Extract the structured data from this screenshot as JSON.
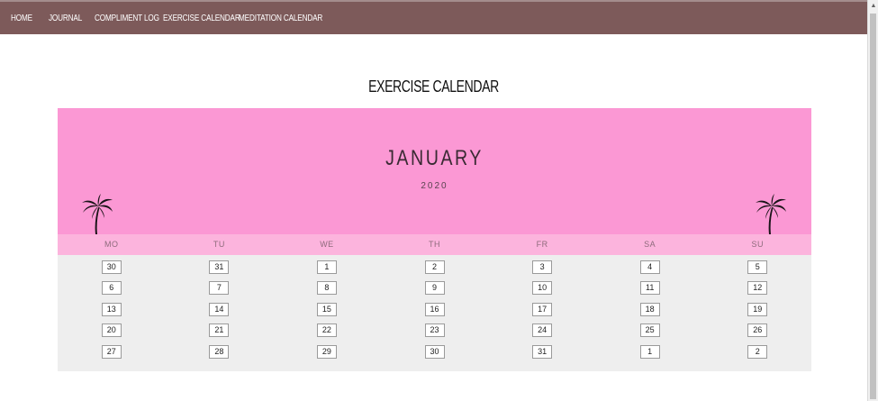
{
  "nav": {
    "items": [
      "HOME",
      "JOURNAL",
      "COMPLIMENT LOG",
      "EXERCISE CALENDAR",
      "MEDITATION CALENDAR"
    ]
  },
  "page": {
    "title": "EXERCISE CALENDAR"
  },
  "calendar": {
    "month": "JANUARY",
    "year": "2020",
    "weekdays": [
      "MO",
      "TU",
      "WE",
      "TH",
      "FR",
      "SA",
      "SU"
    ],
    "weeks": [
      [
        "30",
        "31",
        "1",
        "2",
        "3",
        "4",
        "5"
      ],
      [
        "6",
        "7",
        "8",
        "9",
        "10",
        "11",
        "12"
      ],
      [
        "13",
        "14",
        "15",
        "16",
        "17",
        "18",
        "19"
      ],
      [
        "20",
        "21",
        "22",
        "23",
        "24",
        "25",
        "26"
      ],
      [
        "27",
        "28",
        "29",
        "30",
        "31",
        "1",
        "2"
      ]
    ]
  },
  "colors": {
    "nav_bg": "#7d5a5a",
    "header_bg": "#fb98d4",
    "weekday_bg": "#fcb4dd",
    "body_bg": "#eeeeee"
  },
  "icons": {
    "decoration": "palm-tree-icon"
  }
}
